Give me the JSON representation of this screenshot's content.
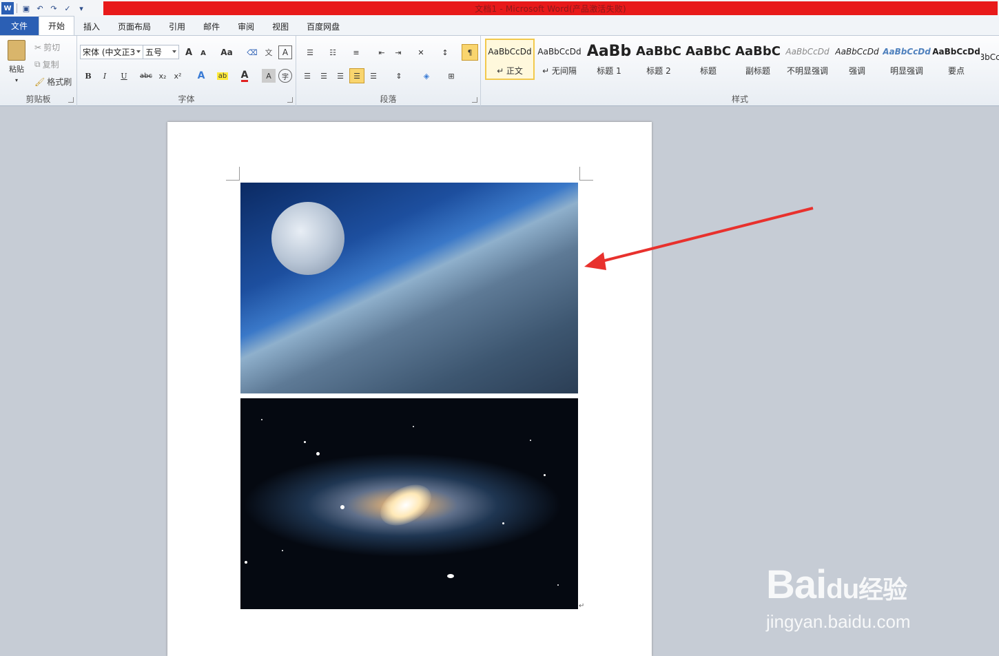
{
  "window": {
    "title": "文档1  -  Microsoft Word(产品激活失败)",
    "qat_icons": [
      "word-app-icon",
      "save-icon",
      "undo-icon",
      "redo-icon",
      "spellcheck-icon",
      "customize-qat-icon"
    ]
  },
  "tabs": [
    {
      "label": "文件"
    },
    {
      "label": "开始"
    },
    {
      "label": "插入"
    },
    {
      "label": "页面布局"
    },
    {
      "label": "引用"
    },
    {
      "label": "邮件"
    },
    {
      "label": "审阅"
    },
    {
      "label": "视图"
    },
    {
      "label": "百度网盘"
    }
  ],
  "clipboard": {
    "group_label": "剪贴板",
    "paste": "粘贴",
    "cut": "剪切",
    "copy": "复制",
    "format_painter": "格式刷"
  },
  "font": {
    "group_label": "字体",
    "font_name": "宋体 (中文正3",
    "font_size": "五号",
    "grow": "A",
    "shrink": "A",
    "case": "Aa",
    "bold": "B",
    "italic": "I",
    "underline": "U",
    "strike": "abc",
    "subscript": "x₂",
    "superscript": "x²"
  },
  "paragraph": {
    "group_label": "段落"
  },
  "styles": {
    "group_label": "样式",
    "items": [
      {
        "sample": "AaBbCcDd",
        "name": "↵ 正文"
      },
      {
        "sample": "AaBbCcDd",
        "name": "↵ 无间隔"
      },
      {
        "sample": "AaBb",
        "name": "标题 1"
      },
      {
        "sample": "AaBbC",
        "name": "标题 2"
      },
      {
        "sample": "AaBbC",
        "name": "标题"
      },
      {
        "sample": "AaBbC",
        "name": "副标题"
      },
      {
        "sample": "AaBbCcDd",
        "name": "不明显强调"
      },
      {
        "sample": "AaBbCcDd",
        "name": "强调"
      },
      {
        "sample": "AaBbCcDd",
        "name": "明显强调"
      },
      {
        "sample": "AaBbCcDd",
        "name": "要点"
      },
      {
        "sample": "AaBbCcDd",
        "name": ""
      }
    ]
  },
  "document": {
    "paragraph_mark": "↵"
  },
  "annotation": {
    "arrow_color": "#e8312d"
  },
  "watermark": {
    "logo": "Bai经验",
    "url": "jingyan.baidu.com"
  }
}
